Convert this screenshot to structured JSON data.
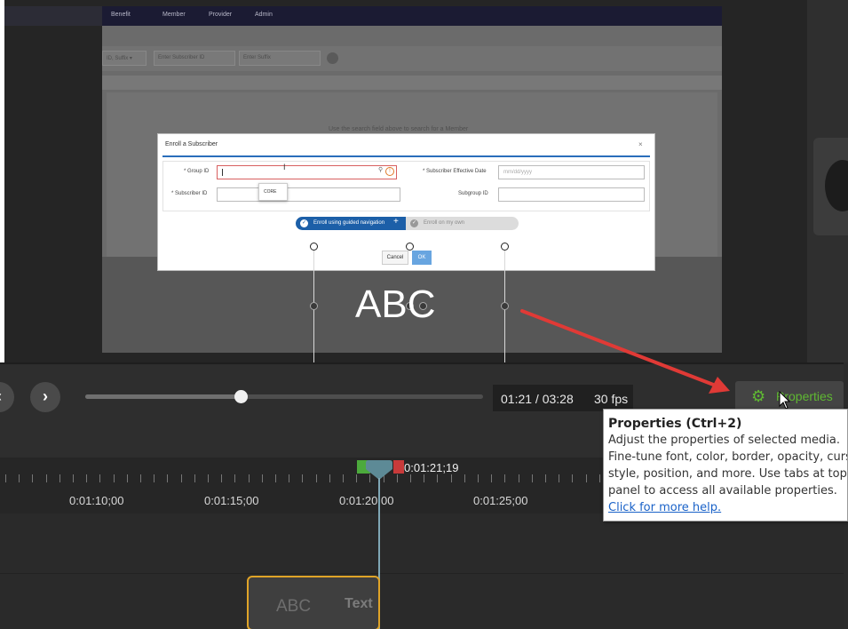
{
  "recorded_page": {
    "nav": [
      "Benefit",
      "Member",
      "Provider",
      "Admin"
    ],
    "filter_label": "ID, Suffix",
    "subscriber_placeholder": "Enter Subscriber ID",
    "suffix_placeholder": "Enter Suffix",
    "hint": "Use the search field above to search for a Member"
  },
  "dialog": {
    "title": "Enroll a Subscriber",
    "close": "×",
    "group_id_label": "* Group ID",
    "subscriber_id_label": "* Subscriber ID",
    "effective_date_label": "* Subscriber Effective Date",
    "effective_date_placeholder": "mm/dd/yyyy",
    "subgroup_id_label": "Subgroup ID",
    "group_dropdown_option": "CORE",
    "toggle_guided": "Enroll using guided navigation",
    "toggle_own": "Enroll on my own",
    "cancel": "Cancel",
    "ok": "OK"
  },
  "canvas": {
    "caption_text": "ABC"
  },
  "playback": {
    "prev_icon": "‹",
    "next_icon": "›",
    "time": "01:21 / 03:28",
    "fps": "30 fps",
    "progress": 0.39
  },
  "properties_button": {
    "label": "Properties",
    "icon": "gear-icon"
  },
  "tooltip": {
    "title": "Properties (Ctrl+2)",
    "lines": [
      "Adjust the properties of selected media.",
      "Fine-tune font, color, border, opacity, cursor,",
      "style, position, and more. Use tabs at top of",
      "panel to access all available properties."
    ],
    "link": "Click for more help."
  },
  "timeline": {
    "timecodes": [
      "0:01:10;00",
      "0:01:15;00",
      "0:01:20;00",
      "0:01:25;00"
    ],
    "playhead_time": "0:01:21;19",
    "clip": {
      "caption": "ABC",
      "type": "Text"
    }
  },
  "colors": {
    "accent_green": "#5fb832",
    "clip_border": "#e0a428",
    "arrow_red": "#e03a36"
  }
}
